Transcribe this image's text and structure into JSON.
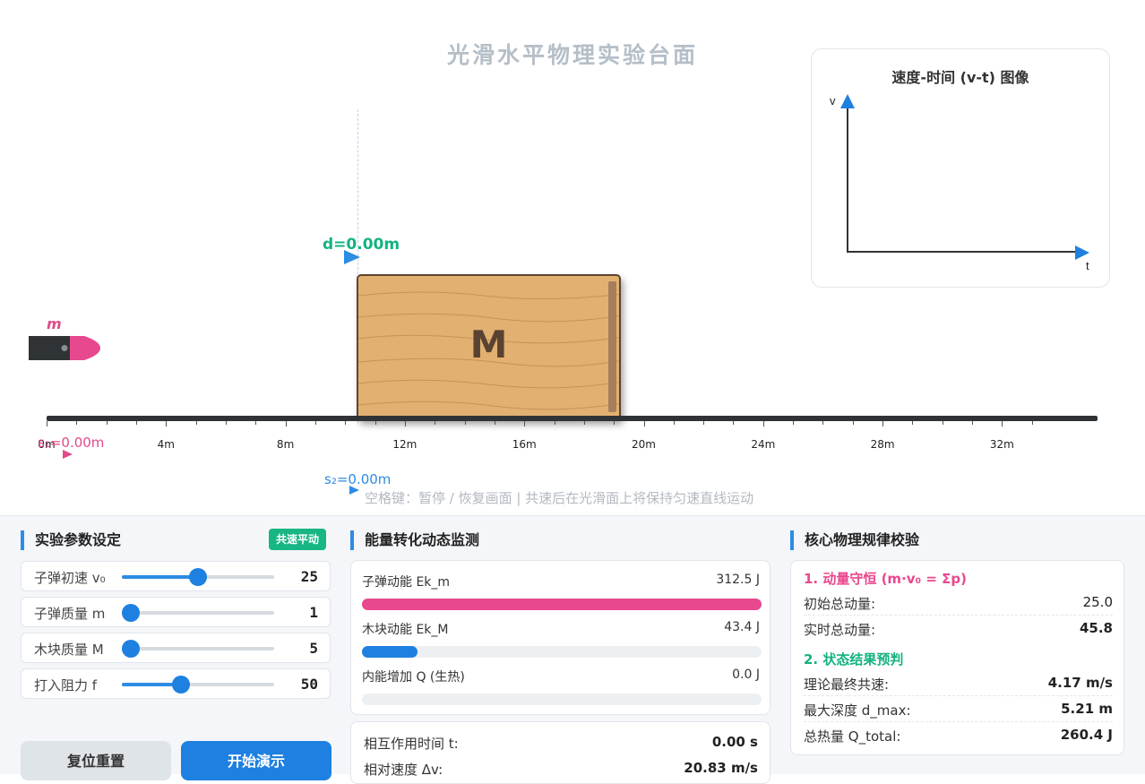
{
  "stage": {
    "title": "光滑水平物理实验台面",
    "d_label": "d=0.00m",
    "block_label": "M",
    "bullet_label": "m",
    "s1_label": "s₁=0.00m",
    "s2_label": "s₂=0.00m",
    "hint": "空格键：暂停 / 恢复画面 | 共速后在光滑面上将保持匀速直线运动",
    "ruler_ticks": [
      "0m",
      "4m",
      "8m",
      "12m",
      "16m",
      "20m",
      "24m",
      "28m",
      "32m"
    ]
  },
  "chart_data": {
    "type": "line",
    "title": "速度-时间 (v-t) 图像",
    "xlabel": "t",
    "ylabel": "v",
    "series": [],
    "grid": false
  },
  "params": {
    "title": "实验参数设定",
    "badge": "共速平动",
    "rows": [
      {
        "label": "子弹初速 v₀",
        "value": "25",
        "fraction": 0.5
      },
      {
        "label": "子弹质量 m",
        "value": "1",
        "fraction": 0.0
      },
      {
        "label": "木块质量 M",
        "value": "5",
        "fraction": 0.0
      },
      {
        "label": "打入阻力 f",
        "value": "50",
        "fraction": 0.39
      }
    ],
    "reset_label": "复位重置",
    "start_label": "开始演示"
  },
  "energy": {
    "title": "能量转化动态监测",
    "rows": [
      {
        "label": "子弹动能 Ek_m",
        "value": "312.5 J",
        "fraction": 1.0,
        "color": "#e8488e"
      },
      {
        "label": "木块动能 Ek_M",
        "value": "43.4 J",
        "fraction": 0.139,
        "color": "#1e80e0"
      },
      {
        "label": "内能增加 Q (生热)",
        "value": "0.0 J",
        "fraction": 0.0,
        "color": "#f0a030"
      }
    ],
    "stats": [
      {
        "label": "相互作用时间 t:",
        "value": "0.00 s"
      },
      {
        "label": "相对速度 Δv:",
        "value": "20.83 m/s"
      }
    ]
  },
  "laws": {
    "title": "核心物理规律校验",
    "momentum": {
      "heading": "1. 动量守恒 (m·v₀ = Σp)",
      "heading_color": "#e8488e",
      "rows": [
        {
          "label": "初始总动量:",
          "value": "25.0"
        },
        {
          "label": "实时总动量:",
          "value": "45.8"
        }
      ]
    },
    "prediction": {
      "heading": "2. 状态结果预判",
      "heading_color": "#13b281",
      "rows": [
        {
          "label": "理论最终共速:",
          "value": "4.17 m/s"
        },
        {
          "label": "最大深度 d_max:",
          "value": "5.21 m"
        },
        {
          "label": "总热量 Q_total:",
          "value": "260.4 J"
        }
      ]
    }
  },
  "colors": {
    "accent": "#1e80e0",
    "bullet": "#e8488e",
    "green": "#13b281",
    "wood": "#e2b070"
  }
}
